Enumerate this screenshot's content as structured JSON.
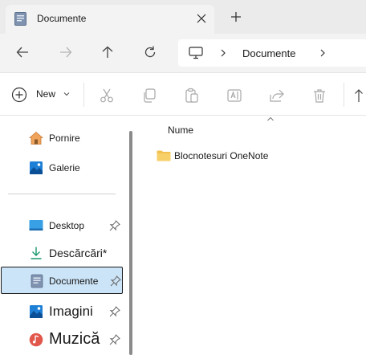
{
  "tabs": [
    {
      "title": "Documente"
    }
  ],
  "address": {
    "location": "Documente"
  },
  "commandbar": {
    "new_label": "New"
  },
  "sidebar": {
    "items": [
      {
        "label": "Pornire",
        "icon": "home-icon"
      },
      {
        "label": "Galerie",
        "icon": "gallery-icon"
      },
      {
        "label": "Desktop",
        "icon": "desktop-folder-icon",
        "pinned": true
      },
      {
        "label": "Descărcări*",
        "icon": "downloads-icon"
      },
      {
        "label": "Documente",
        "icon": "documents-icon",
        "pinned": true,
        "selected": true
      },
      {
        "label": "Imagini",
        "icon": "pictures-icon",
        "pinned": true
      },
      {
        "label": "Muzică",
        "icon": "music-icon",
        "pinned": true
      }
    ]
  },
  "content": {
    "columns": [
      "Nume"
    ],
    "rows": [
      {
        "name": "Blocnotesuri OneNote",
        "icon": "folder-icon"
      }
    ]
  },
  "colors": {
    "selection": "#cce4f7",
    "folder": "#f3c14f",
    "accent": "#0067c0"
  }
}
